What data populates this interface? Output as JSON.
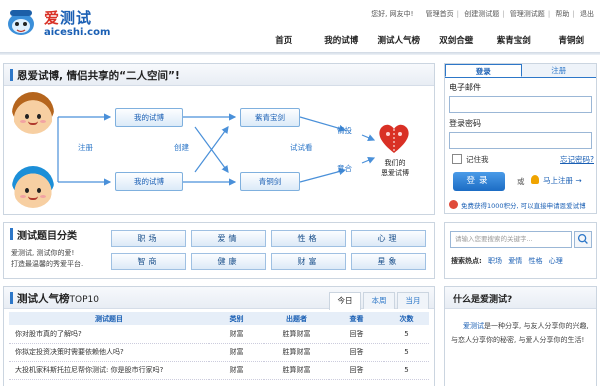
{
  "logo": {
    "cn_prefix": "爱",
    "cn_rest": "测试",
    "en": "aiceshi.com"
  },
  "top_links": {
    "greeting": "您好, 网友中!",
    "items": [
      "管理首页",
      "创建测试题",
      "管理测试题",
      "帮助",
      "退出"
    ]
  },
  "nav": [
    "首页",
    "我的试博",
    "测试人气榜",
    "双剑合璧",
    "紫青宝剑",
    "青铜剑"
  ],
  "hero": {
    "title": "恩爱试博, 情侣共享的“二人空间”!",
    "box_top": "我的试博",
    "box_bottom": "我的试博",
    "box_sword_purple": "紫青宝剑",
    "box_sword_bronze": "青铜剑",
    "label_register": "注册",
    "label_create": "创建",
    "label_test": "试试看",
    "label_love": "情投",
    "label_match": "意合",
    "caption_line1": "我们的",
    "caption_line2": "恩爱试博"
  },
  "categories": {
    "title": "测试题目分类",
    "desc_line1": "爱测试, 测试你的爱!",
    "desc_line2": "打造最温馨的秀爱平台.",
    "items": [
      "职场",
      "爱情",
      "性格",
      "心理",
      "智商",
      "健康",
      "财富",
      "星象"
    ]
  },
  "ranking": {
    "title_main": "测试人气榜",
    "title_suffix": "TOP10",
    "tabs": [
      "今日",
      "本周",
      "当月"
    ],
    "active_tab": "今日",
    "columns": [
      "测试题目",
      "类别",
      "出题者",
      "查看",
      "次数"
    ],
    "rows": [
      [
        "你对股市真的了解吗?",
        "财富",
        "胜算财富",
        "回答",
        "5"
      ],
      [
        "你拟定投资决策时需要依赖他人吗?",
        "财富",
        "胜算财富",
        "回答",
        "5"
      ],
      [
        "大投机家科斯托拉尼帮你测试: 你是股市行家吗?",
        "财富",
        "胜算财富",
        "回答",
        "5"
      ]
    ]
  },
  "login": {
    "tab_login": "登录",
    "tab_register": "注册",
    "email_label": "电子邮件",
    "password_label": "登录密码",
    "remember": "记住我",
    "forgot": "忘记密码?",
    "submit": "登录",
    "or": "或",
    "register_link": "马上注册 →",
    "promo": "免费获得1000积分, 可以直接申请恩爱试博"
  },
  "search": {
    "placeholder": "请输入您要搜索的关键字...",
    "hot_label": "搜索热点:",
    "hot_terms": [
      "职场",
      "爱情",
      "性格",
      "心理"
    ]
  },
  "about": {
    "title": "什么是爱测试?",
    "brand": "爱测试",
    "body": "是一种分享, 与友人分享你的兴趣, 与恋人分享你的秘密, 与爱人分享你的生活!"
  },
  "colors": {
    "brand_blue": "#1a5fb4",
    "accent_blue": "#2d77c8",
    "heart_red": "#d93025"
  }
}
